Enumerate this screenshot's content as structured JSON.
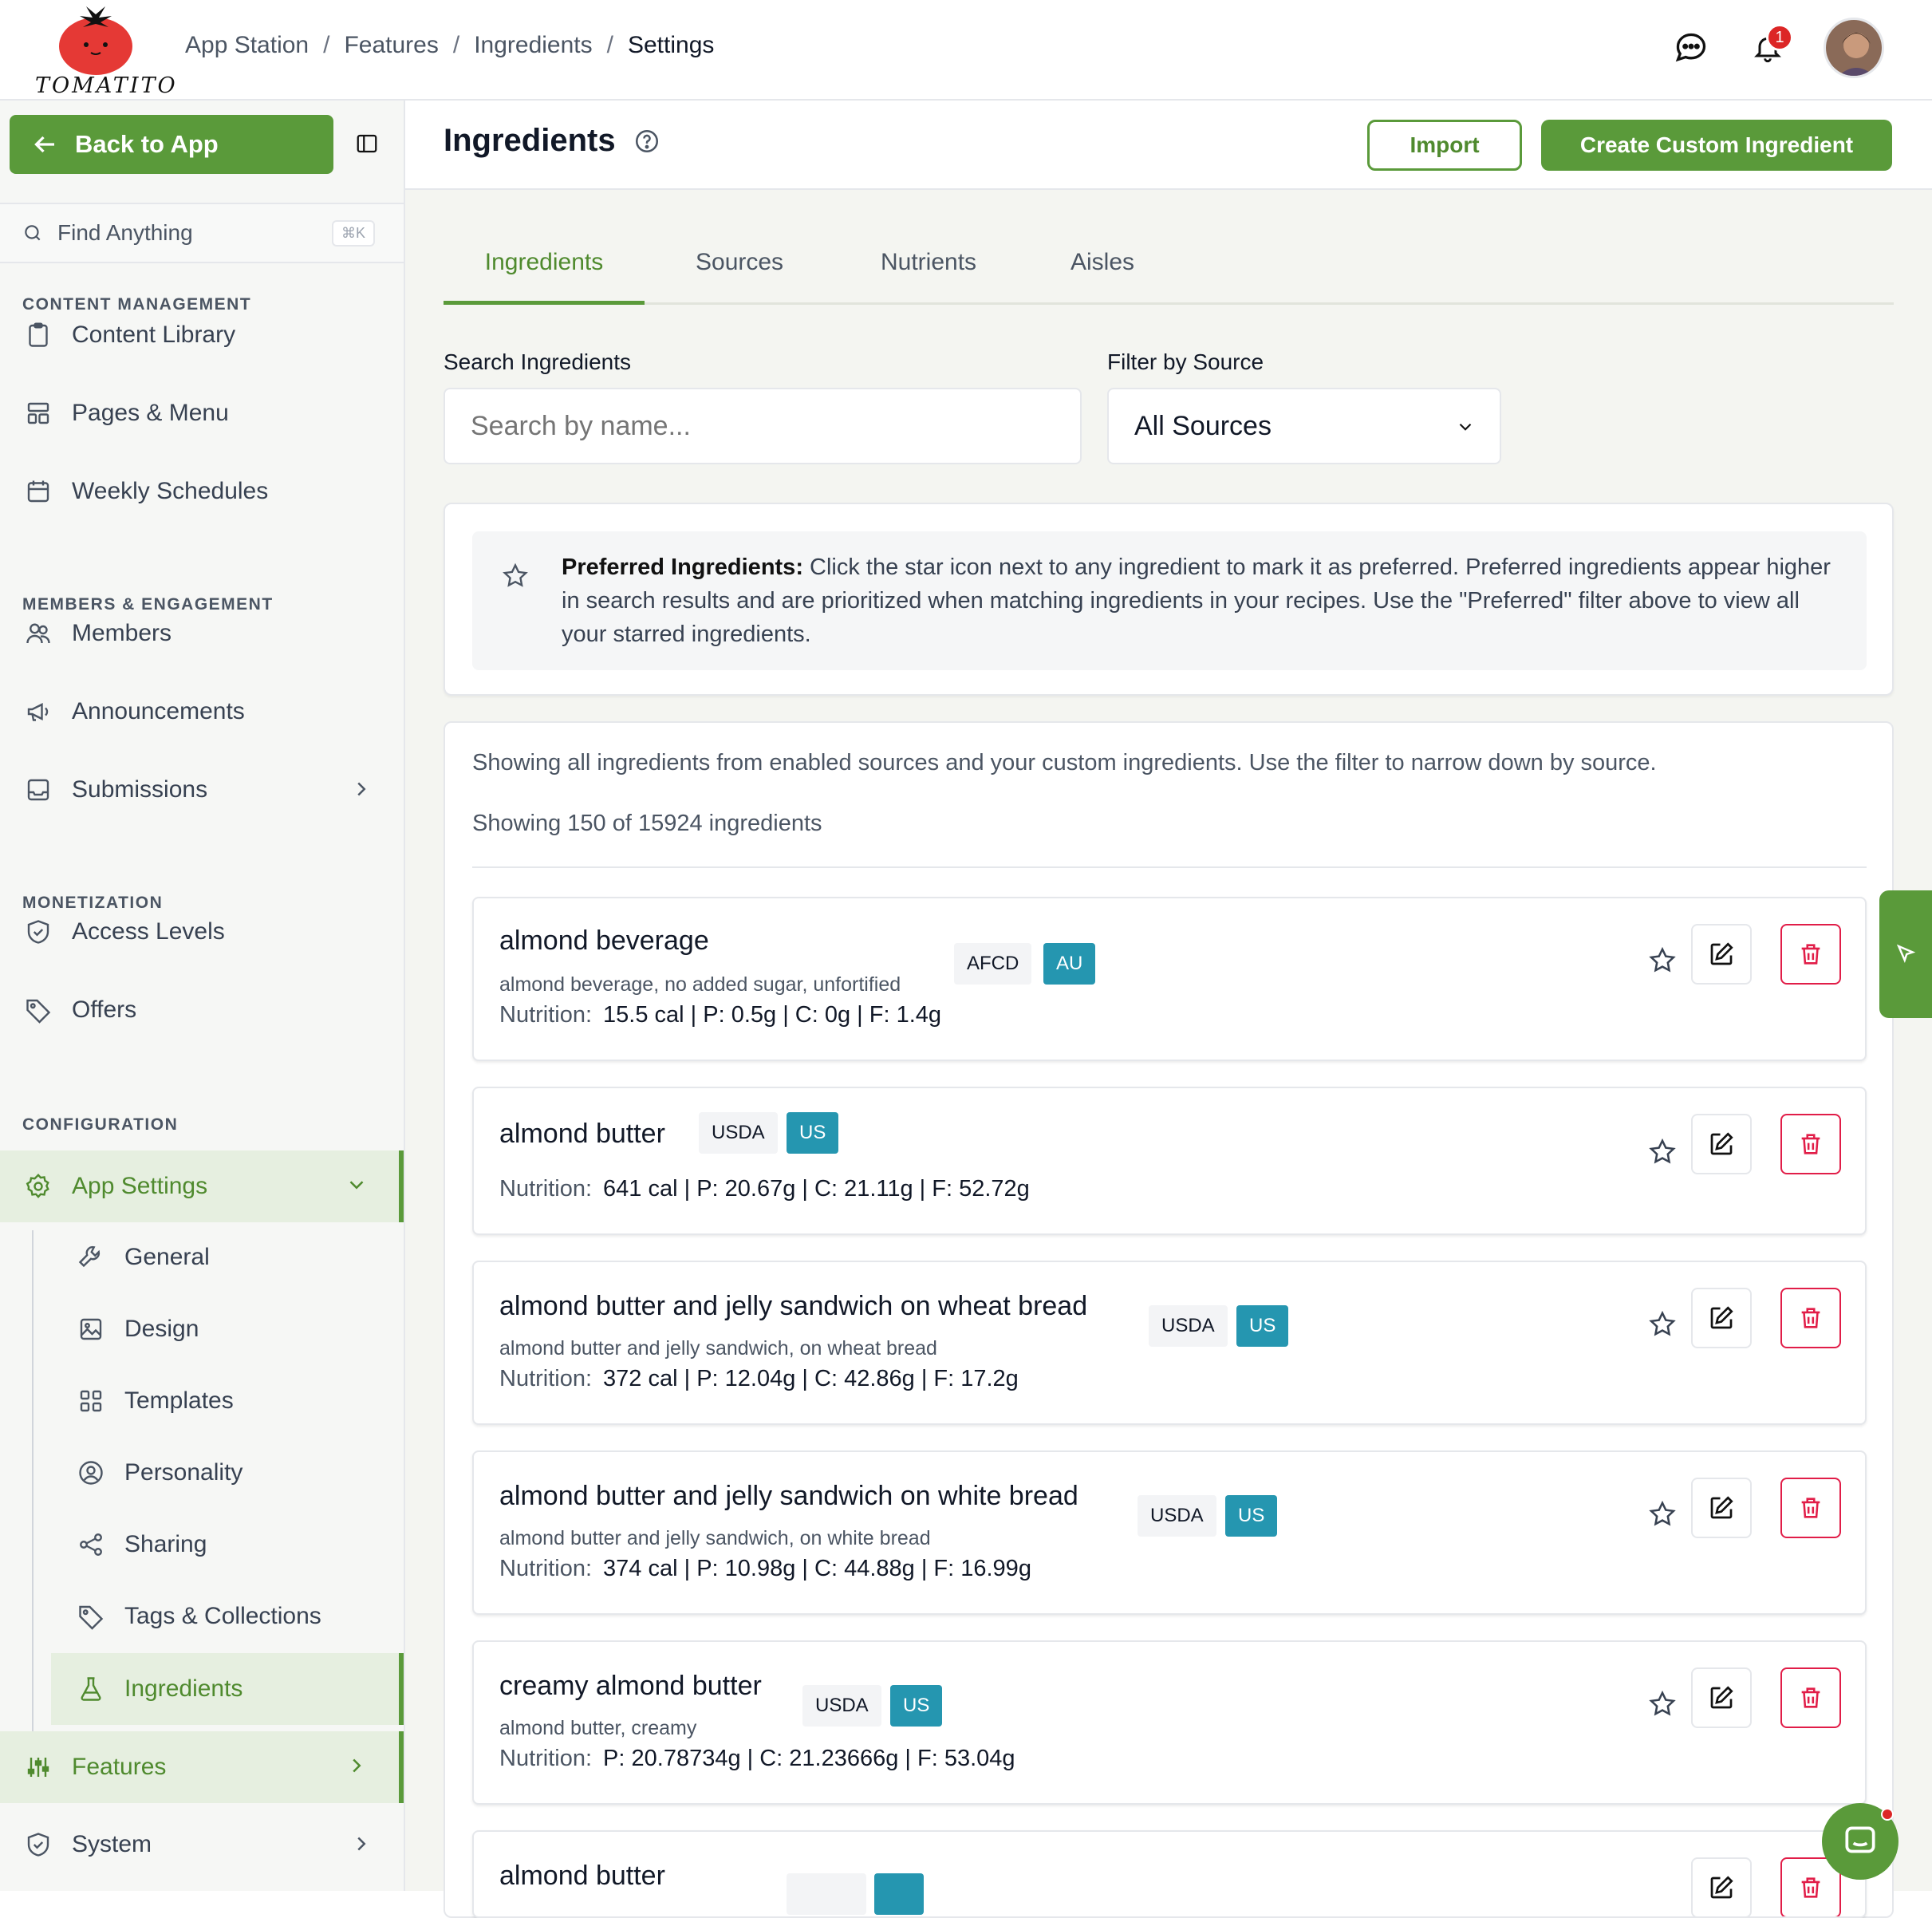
{
  "brand": {
    "logo_text": "TOMATITO"
  },
  "breadcrumb": [
    "App Station",
    "Features",
    "Ingredients",
    "Settings"
  ],
  "notifications": {
    "count": "1"
  },
  "sidebar": {
    "back_label": "Back to App",
    "search_placeholder": "Find Anything",
    "search_shortcut": "⌘K",
    "sections": {
      "content": "CONTENT MANAGEMENT",
      "members": "MEMBERS & ENGAGEMENT",
      "monetization": "MONETIZATION",
      "configuration": "CONFIGURATION"
    },
    "items": {
      "content_library": "Content Library",
      "pages_menu": "Pages & Menu",
      "weekly_schedules": "Weekly Schedules",
      "members": "Members",
      "announcements": "Announcements",
      "submissions": "Submissions",
      "access_levels": "Access Levels",
      "offers": "Offers",
      "app_settings": "App Settings",
      "features": "Features",
      "system": "System"
    },
    "sub_items": {
      "general": "General",
      "design": "Design",
      "templates": "Templates",
      "personality": "Personality",
      "sharing": "Sharing",
      "tags_collections": "Tags & Collections",
      "ingredients": "Ingredients"
    }
  },
  "header": {
    "title": "Ingredients",
    "import_label": "Import",
    "create_label": "Create Custom Ingredient"
  },
  "tabs": [
    "Ingredients",
    "Sources",
    "Nutrients",
    "Aisles"
  ],
  "filters": {
    "search_label": "Search Ingredients",
    "search_placeholder": "Search by name...",
    "source_label": "Filter by Source",
    "source_value": "All Sources"
  },
  "info": {
    "title": "Preferred Ingredients:",
    "text": "Click the star icon next to any ingredient to mark it as preferred. Preferred ingredients appear higher in search results and are prioritized when matching ingredients in your recipes. Use the \"Preferred\" filter above to view all your starred ingredients."
  },
  "list": {
    "description": "Showing all ingredients from enabled sources and your custom ingredients. Use the filter to narrow down by source.",
    "count_text": "Showing 150 of 15924 ingredients",
    "nutrition_label": "Nutrition:",
    "rows": [
      {
        "name": "almond beverage",
        "desc": "almond beverage, no added sugar, unfortified",
        "nutrition": "15.5 cal | P: 0.5g | C: 0g | F: 1.4g",
        "source": "AFCD",
        "region": "AU"
      },
      {
        "name": "almond butter",
        "desc": "",
        "nutrition": "641 cal | P: 20.67g | C: 21.11g | F: 52.72g",
        "source": "USDA",
        "region": "US"
      },
      {
        "name": "almond butter and jelly sandwich on wheat bread",
        "desc": "almond butter and jelly sandwich, on wheat bread",
        "nutrition": "372 cal | P: 12.04g | C: 42.86g | F: 17.2g",
        "source": "USDA",
        "region": "US"
      },
      {
        "name": "almond butter and jelly sandwich on white bread",
        "desc": "almond butter and jelly sandwich, on white bread",
        "nutrition": "374 cal | P: 10.98g | C: 44.88g | F: 16.99g",
        "source": "USDA",
        "region": "US"
      },
      {
        "name": "creamy almond butter",
        "desc": "almond butter, creamy",
        "nutrition": "P: 20.78734g | C: 21.23666g | F: 53.04g",
        "source": "USDA",
        "region": "US"
      },
      {
        "name": "almond butter",
        "desc": "",
        "nutrition": "",
        "source": "",
        "region": ""
      }
    ]
  },
  "colors": {
    "brand_green": "#5a9a3a",
    "region_blue": "#2596b0",
    "danger": "#e11d48"
  }
}
